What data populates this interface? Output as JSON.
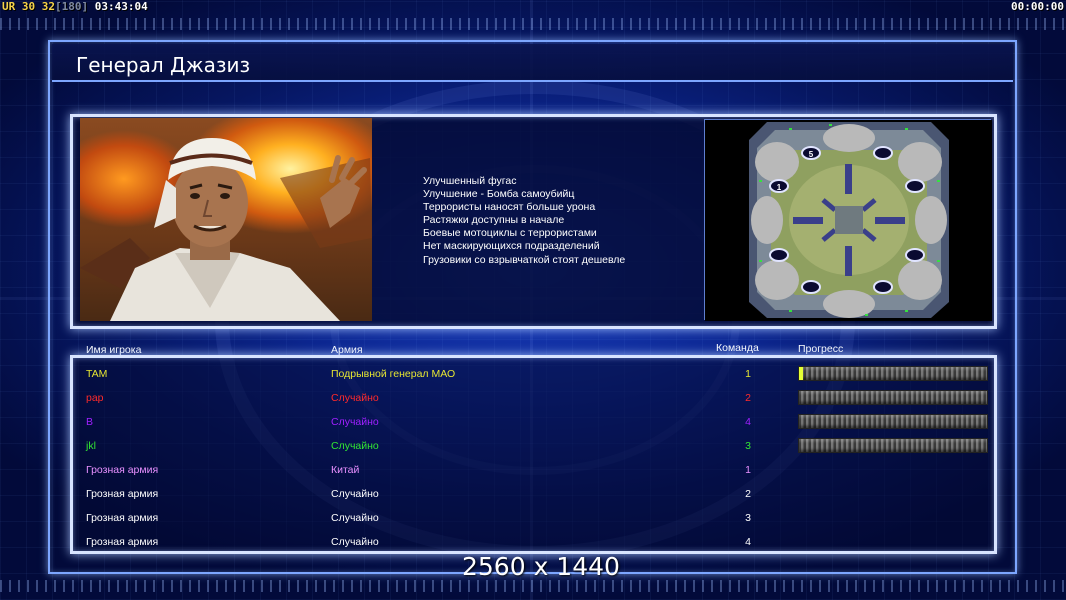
{
  "hud": {
    "mode_label": "UR",
    "fps": "30",
    "fps_alt": "32",
    "fps_cap": "[180]",
    "elapsed": "03:43:04",
    "timer": "00:00:00"
  },
  "title": "Генерал Джазиз",
  "general_features": [
    "Улучшенный фугас",
    "Улучшение - Бомба самоубийц",
    "Террористы наносят больше урона",
    "Растяжки доступны в начале",
    "Боевые мотоциклы с террористами",
    "Нет маскирующихся подразделений",
    "Грузовики со взрывчаткой стоят дешевле"
  ],
  "minimap": {
    "start_labels": [
      "5",
      "1"
    ]
  },
  "table": {
    "headers": {
      "name": "Имя игрока",
      "army": "Армия",
      "team": "Команда",
      "progress": "Прогресс"
    },
    "players": [
      {
        "name": "TAM",
        "army": "Подрывной генерал МАО",
        "team": "1",
        "color": "#e6e632",
        "progress": 0.02
      },
      {
        "name": "pap",
        "army": "Случайно",
        "team": "2",
        "color": "#ff2a2a",
        "progress": 0
      },
      {
        "name": "B",
        "army": "Случайно",
        "team": "4",
        "color": "#a020ff",
        "progress": 0
      },
      {
        "name": "jkl",
        "army": "Случайно",
        "team": "3",
        "color": "#32e632",
        "progress": 0
      },
      {
        "name": "Грозная армия",
        "army": "Китай",
        "team": "1",
        "color": "#e890ff"
      },
      {
        "name": "Грозная армия",
        "army": "Случайно",
        "team": "2",
        "color": "#ffffff"
      },
      {
        "name": "Грозная армия",
        "army": "Случайно",
        "team": "3",
        "color": "#ffffff"
      },
      {
        "name": "Грозная армия",
        "army": "Случайно",
        "team": "4",
        "color": "#ffffff"
      }
    ]
  },
  "resolution_overlay": "2560 x 1440"
}
